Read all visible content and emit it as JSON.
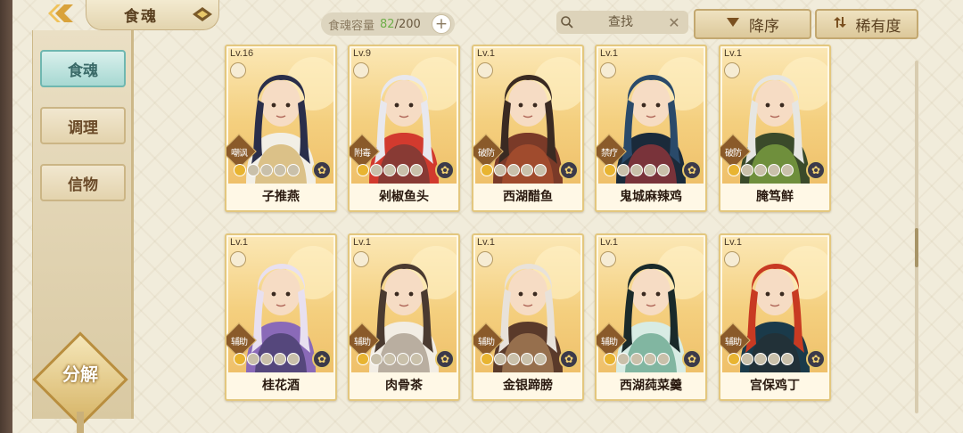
{
  "header": {
    "title": "食魂",
    "capacity": {
      "label": "食魂容量",
      "current": "82",
      "separator": "/",
      "max": "200"
    },
    "search": {
      "placeholder": "查找"
    },
    "sort_order_label": "降序",
    "sort_by_label": "稀有度"
  },
  "sidebar": {
    "items": [
      {
        "label": "食魂",
        "active": true
      },
      {
        "label": "调理",
        "active": false
      },
      {
        "label": "信物",
        "active": false
      }
    ],
    "decompose_label": "分解"
  },
  "cards": [
    {
      "level": "Lv.16",
      "tag": "嘲讽",
      "name": "子推燕",
      "stars_on": 1,
      "palette": [
        "#2a2e4a",
        "#f2efe6",
        "#c89a3a"
      ]
    },
    {
      "level": "Lv.9",
      "tag": "附毒",
      "name": "剁椒鱼头",
      "stars_on": 1,
      "palette": [
        "#e8e8ee",
        "#d23a2e",
        "#4a3a3a"
      ]
    },
    {
      "level": "Lv.1",
      "tag": "破防",
      "name": "西湖醋鱼",
      "stars_on": 1,
      "palette": [
        "#3a2a22",
        "#7a3a28",
        "#c05a32"
      ]
    },
    {
      "level": "Lv.1",
      "tag": "禁疗",
      "name": "鬼城麻辣鸡",
      "stars_on": 1,
      "palette": [
        "#2a4a6a",
        "#1a2a3a",
        "#c83a3a"
      ]
    },
    {
      "level": "Lv.1",
      "tag": "破防",
      "name": "腌笃鲜",
      "stars_on": 1,
      "palette": [
        "#e6e6e2",
        "#3a4a2a",
        "#9ac84a"
      ]
    },
    {
      "level": "Lv.1",
      "tag": "辅助",
      "name": "桂花酒",
      "stars_on": 1,
      "palette": [
        "#e8e0f0",
        "#8a6ab8",
        "#2a2a4a"
      ]
    },
    {
      "level": "Lv.1",
      "tag": "辅助",
      "name": "肉骨茶",
      "stars_on": 1,
      "palette": [
        "#4a3a30",
        "#f2ede4",
        "#8a7a68"
      ]
    },
    {
      "level": "Lv.1",
      "tag": "辅助",
      "name": "金银蹄膀",
      "stars_on": 1,
      "palette": [
        "#e8e2da",
        "#5a3a2a",
        "#c89a6a"
      ]
    },
    {
      "level": "Lv.1",
      "tag": "辅助",
      "name": "西湖莼菜羹",
      "stars_on": 1,
      "palette": [
        "#1a2a2a",
        "#d8ece4",
        "#3a8a6a"
      ]
    },
    {
      "level": "Lv.1",
      "tag": "辅助",
      "name": "宫保鸡丁",
      "stars_on": 1,
      "palette": [
        "#c83a22",
        "#1a3a4a",
        "#2a2a2a"
      ]
    }
  ],
  "colors": {
    "accent_gold": "#e3c77e",
    "active_tab": "#a7d8d2",
    "capacity_value": "#6fae4a"
  },
  "icons": {
    "back": "back-arrow-icon",
    "badge": "title-badge-icon",
    "add": "plus-icon",
    "search": "search-icon",
    "clear": "close-icon",
    "sort_order": "triangle-down-icon",
    "sort_by": "rarity-sort-icon",
    "element": "element-flower-icon",
    "star": "star-pip-icon"
  }
}
